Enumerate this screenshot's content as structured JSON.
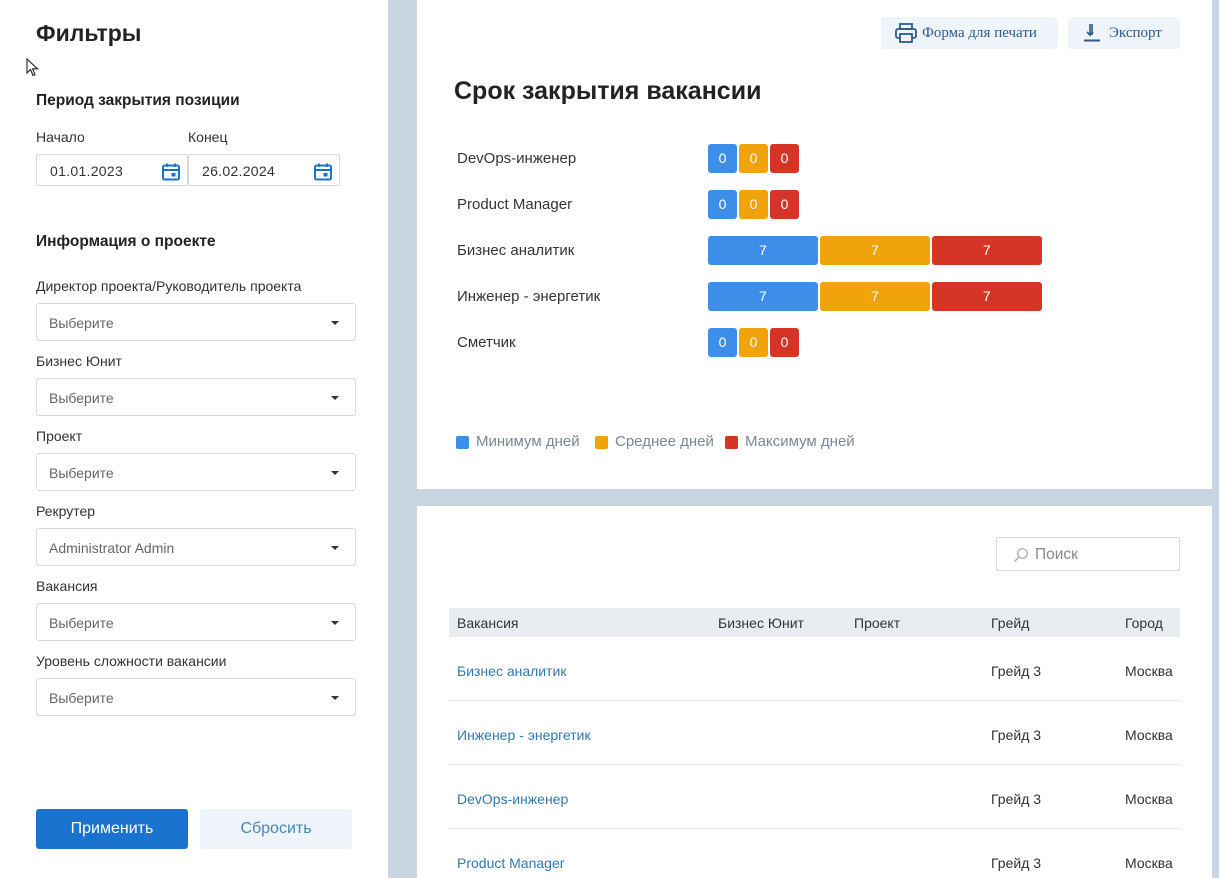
{
  "sidebar": {
    "title": "Фильтры",
    "period_heading": "Период закрытия позиции",
    "start_label": "Начало",
    "end_label": "Конец",
    "start_date": "01.01.2023",
    "end_date": "26.02.2024",
    "project_heading": "Информация о проекте",
    "filters": [
      {
        "label": "Директор проекта/Руководитель проекта",
        "value": "Выберите"
      },
      {
        "label": "Бизнес Юнит",
        "value": "Выберите"
      },
      {
        "label": "Проект",
        "value": "Выберите"
      },
      {
        "label": "Рекрутер",
        "value": "Administrator Admin"
      },
      {
        "label": "Вакансия",
        "value": "Выберите"
      },
      {
        "label": "Уровень сложности вакансии",
        "value": "Выберите"
      }
    ],
    "apply_label": "Применить",
    "reset_label": "Сбросить"
  },
  "toolbar": {
    "print_label": "Форма для печати",
    "export_label": "Экспорт"
  },
  "chart_data": {
    "type": "bar",
    "orientation": "horizontal",
    "stacked": true,
    "title": "Срок закрытия вакансии",
    "categories": [
      "DevOps-инженер",
      "Product Manager",
      "Бизнес аналитик",
      "Инженер - энергетик",
      "Сметчик"
    ],
    "series": [
      {
        "name": "Минимум дней",
        "values": [
          0,
          0,
          7,
          7,
          0
        ],
        "color": "#3d8ee8"
      },
      {
        "name": "Среднее дней",
        "values": [
          0,
          0,
          7,
          7,
          0
        ],
        "color": "#f0a30a"
      },
      {
        "name": "Максимум дней",
        "values": [
          0,
          0,
          7,
          7,
          0
        ],
        "color": "#d63426"
      }
    ],
    "legend_position": "bottom-left"
  },
  "table": {
    "search_placeholder": "Поиск",
    "columns": [
      "Вакансия",
      "Бизнес Юнит",
      "Проект",
      "Грейд",
      "Город"
    ],
    "rows": [
      {
        "vacancy": "Бизнес аналитик",
        "unit": "",
        "project": "",
        "grade": "Грейд 3",
        "city": "Москва"
      },
      {
        "vacancy": "Инженер - энергетик",
        "unit": "",
        "project": "",
        "grade": "Грейд 3",
        "city": "Москва"
      },
      {
        "vacancy": "DevOps-инженер",
        "unit": "",
        "project": "",
        "grade": "Грейд 3",
        "city": "Москва"
      },
      {
        "vacancy": "Product Manager",
        "unit": "",
        "project": "",
        "grade": "Грейд 3",
        "city": "Москва"
      }
    ]
  }
}
